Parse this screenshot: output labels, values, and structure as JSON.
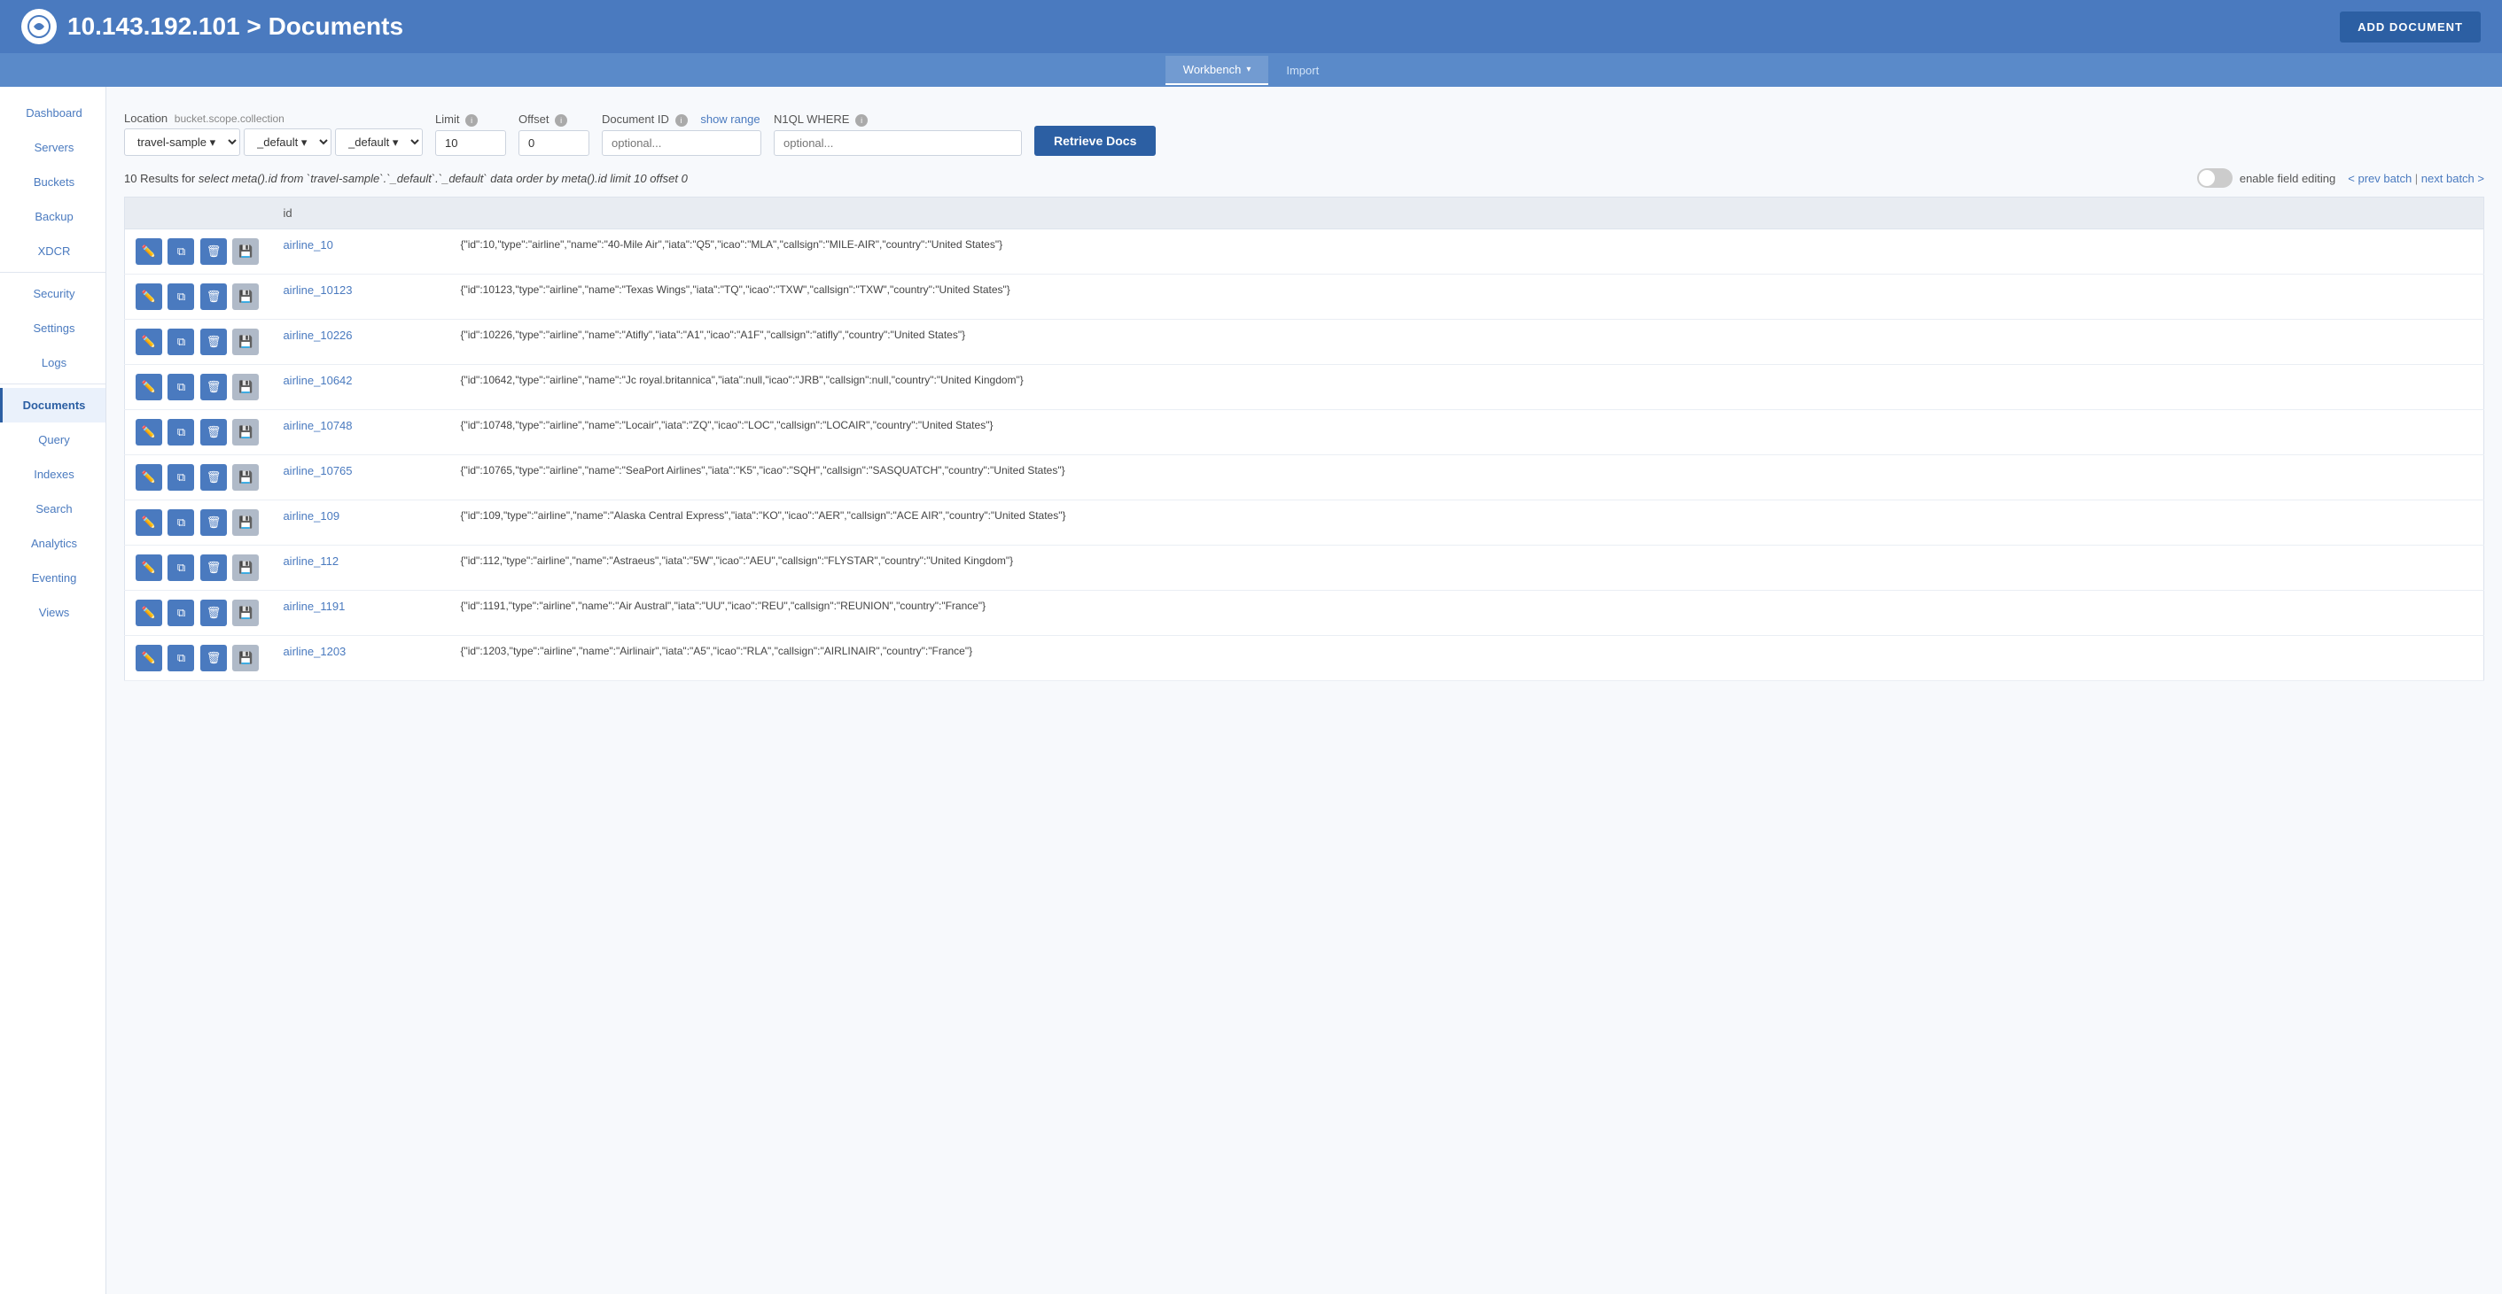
{
  "header": {
    "ip": "10.143.192.101",
    "title": "Documents",
    "add_button": "ADD DOCUMENT"
  },
  "tabs": [
    {
      "label": "Workbench",
      "active": true,
      "has_chevron": true
    },
    {
      "label": "Import",
      "active": false,
      "has_chevron": false
    }
  ],
  "sidebar": {
    "items": [
      {
        "label": "Dashboard",
        "active": false
      },
      {
        "label": "Servers",
        "active": false
      },
      {
        "label": "Buckets",
        "active": false
      },
      {
        "label": "Backup",
        "active": false
      },
      {
        "label": "XDCR",
        "active": false
      },
      {
        "label": "Security",
        "active": false
      },
      {
        "label": "Settings",
        "active": false
      },
      {
        "label": "Logs",
        "active": false
      },
      {
        "label": "Documents",
        "active": true
      },
      {
        "label": "Query",
        "active": false
      },
      {
        "label": "Indexes",
        "active": false
      },
      {
        "label": "Search",
        "active": false
      },
      {
        "label": "Analytics",
        "active": false
      },
      {
        "label": "Eventing",
        "active": false
      },
      {
        "label": "Views",
        "active": false
      }
    ]
  },
  "filters": {
    "location_label": "Location",
    "location_sublabel": "bucket.scope.collection",
    "bucket_options": [
      "travel-sample"
    ],
    "bucket_value": "travel-sample",
    "scope_options": [
      "_default"
    ],
    "scope_value": "_default",
    "collection_options": [
      "_default"
    ],
    "collection_value": "_default",
    "limit_label": "Limit",
    "limit_value": "10",
    "offset_label": "Offset",
    "offset_value": "0",
    "doc_id_label": "Document ID",
    "doc_id_placeholder": "optional...",
    "show_range": "show range",
    "n1ql_label": "N1QL WHERE",
    "n1ql_placeholder": "optional...",
    "retrieve_btn": "Retrieve Docs"
  },
  "results": {
    "count": "10",
    "query": "select meta().id from `travel-sample`.`_default`.`_default` data order by meta().id limit 10 offset 0",
    "toggle_label": "enable field editing",
    "prev_batch": "< prev batch",
    "next_batch": "next batch >",
    "separator": "|"
  },
  "table": {
    "columns": [
      "",
      "id",
      ""
    ],
    "rows": [
      {
        "id": "airline_10",
        "data": "{\"id\":10,\"type\":\"airline\",\"name\":\"40-Mile Air\",\"iata\":\"Q5\",\"icao\":\"MLA\",\"callsign\":\"MILE-AIR\",\"country\":\"United States\"}"
      },
      {
        "id": "airline_10123",
        "data": "{\"id\":10123,\"type\":\"airline\",\"name\":\"Texas Wings\",\"iata\":\"TQ\",\"icao\":\"TXW\",\"callsign\":\"TXW\",\"country\":\"United States\"}"
      },
      {
        "id": "airline_10226",
        "data": "{\"id\":10226,\"type\":\"airline\",\"name\":\"Atifly\",\"iata\":\"A1\",\"icao\":\"A1F\",\"callsign\":\"atifly\",\"country\":\"United States\"}"
      },
      {
        "id": "airline_10642",
        "data": "{\"id\":10642,\"type\":\"airline\",\"name\":\"Jc royal.britannica\",\"iata\":null,\"icao\":\"JRB\",\"callsign\":null,\"country\":\"United Kingdom\"}"
      },
      {
        "id": "airline_10748",
        "data": "{\"id\":10748,\"type\":\"airline\",\"name\":\"Locair\",\"iata\":\"ZQ\",\"icao\":\"LOC\",\"callsign\":\"LOCAIR\",\"country\":\"United States\"}"
      },
      {
        "id": "airline_10765",
        "data": "{\"id\":10765,\"type\":\"airline\",\"name\":\"SeaPort Airlines\",\"iata\":\"K5\",\"icao\":\"SQH\",\"callsign\":\"SASQUATCH\",\"country\":\"United States\"}"
      },
      {
        "id": "airline_109",
        "data": "{\"id\":109,\"type\":\"airline\",\"name\":\"Alaska Central Express\",\"iata\":\"KO\",\"icao\":\"AER\",\"callsign\":\"ACE AIR\",\"country\":\"United States\"}"
      },
      {
        "id": "airline_112",
        "data": "{\"id\":112,\"type\":\"airline\",\"name\":\"Astraeus\",\"iata\":\"5W\",\"icao\":\"AEU\",\"callsign\":\"FLYSTAR\",\"country\":\"United Kingdom\"}"
      },
      {
        "id": "airline_1191",
        "data": "{\"id\":1191,\"type\":\"airline\",\"name\":\"Air Austral\",\"iata\":\"UU\",\"icao\":\"REU\",\"callsign\":\"REUNION\",\"country\":\"France\"}"
      },
      {
        "id": "airline_1203",
        "data": "{\"id\":1203,\"type\":\"airline\",\"name\":\"Airlinair\",\"iata\":\"A5\",\"icao\":\"RLA\",\"callsign\":\"AIRLINAIR\",\"country\":\"France\"}"
      }
    ]
  }
}
